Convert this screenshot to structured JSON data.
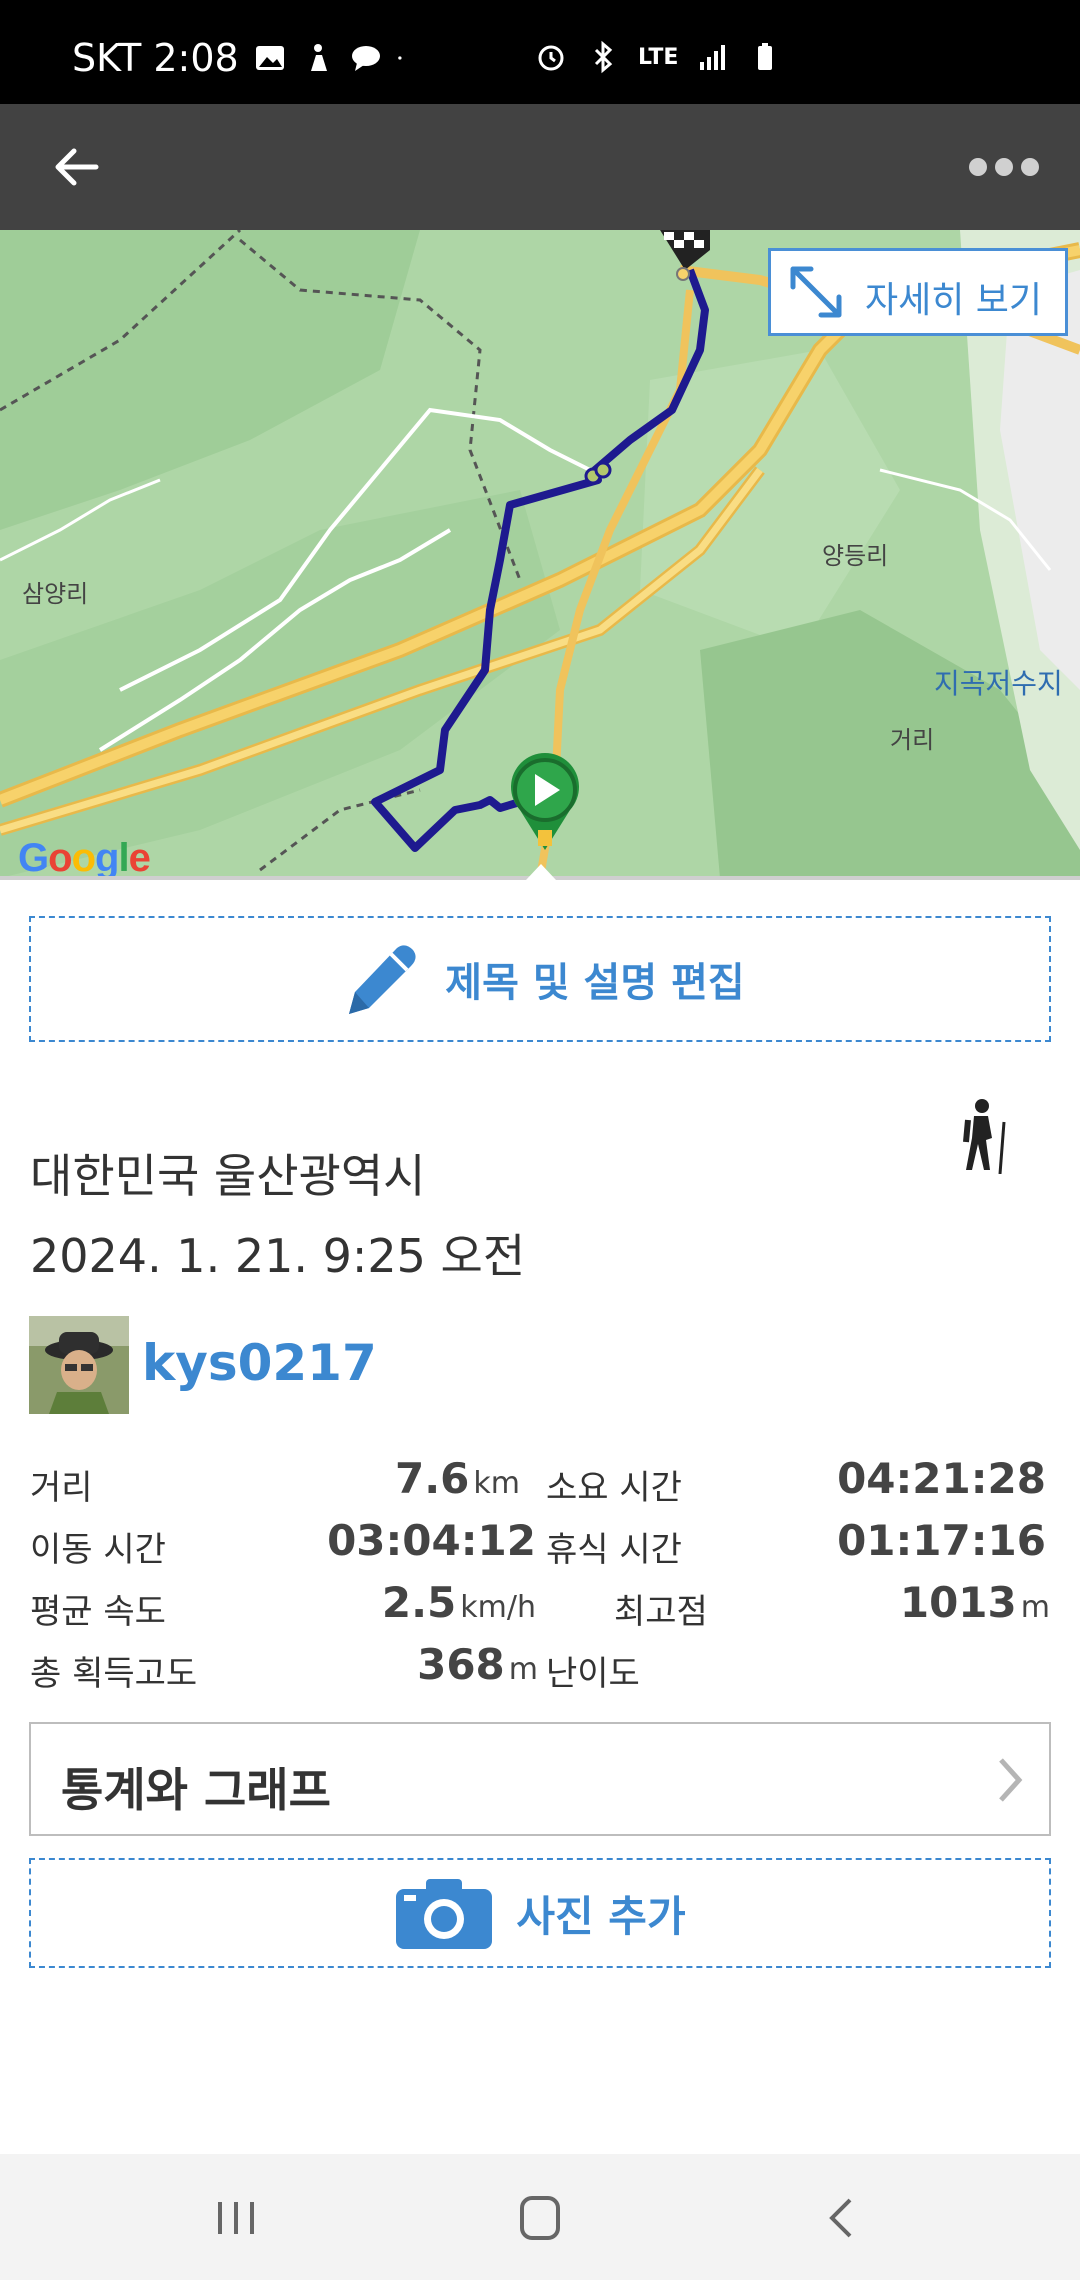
{
  "status_bar": {
    "carrier_time": "SKT 2:08",
    "network": "LTE"
  },
  "app_bar": {
    "back_icon": "arrow-left-icon",
    "more_icon": "more-dots-icon"
  },
  "map": {
    "detail_button_label": "자세히 보기",
    "labels": {
      "samyang": "삼양리",
      "yangdeung": "양등리",
      "jigok_reservoir": "지곡저수지",
      "geori": "거리"
    },
    "logo": "Google",
    "route_color": "#1e1a8f"
  },
  "edit_title_label": "제목 및 설명 편집",
  "location": "대한민국 울산광역시",
  "datetime": "2024. 1. 21. 9:25 오전",
  "user": {
    "name": "kys0217"
  },
  "stats": {
    "distance": {
      "label": "거리",
      "value": "7.6",
      "unit": "km"
    },
    "total_time": {
      "label": "소요 시간",
      "value": "04:21:28"
    },
    "moving_time": {
      "label": "이동 시간",
      "value": "03:04:12"
    },
    "rest_time": {
      "label": "휴식 시간",
      "value": "01:17:16"
    },
    "avg_speed": {
      "label": "평균 속도",
      "value": "2.5",
      "unit": "km/h"
    },
    "max_elevation": {
      "label": "최고점",
      "value": "1013",
      "unit": "m"
    },
    "elevation_gain": {
      "label": "총 획득고도",
      "value": "368",
      "unit": "m"
    },
    "difficulty": {
      "label": "난이도",
      "value": ""
    }
  },
  "stats_graph_label": "통계와 그래프",
  "add_photo_label": "사진 추가",
  "colors": {
    "accent": "#3c88d0",
    "app_bar": "#424242"
  }
}
